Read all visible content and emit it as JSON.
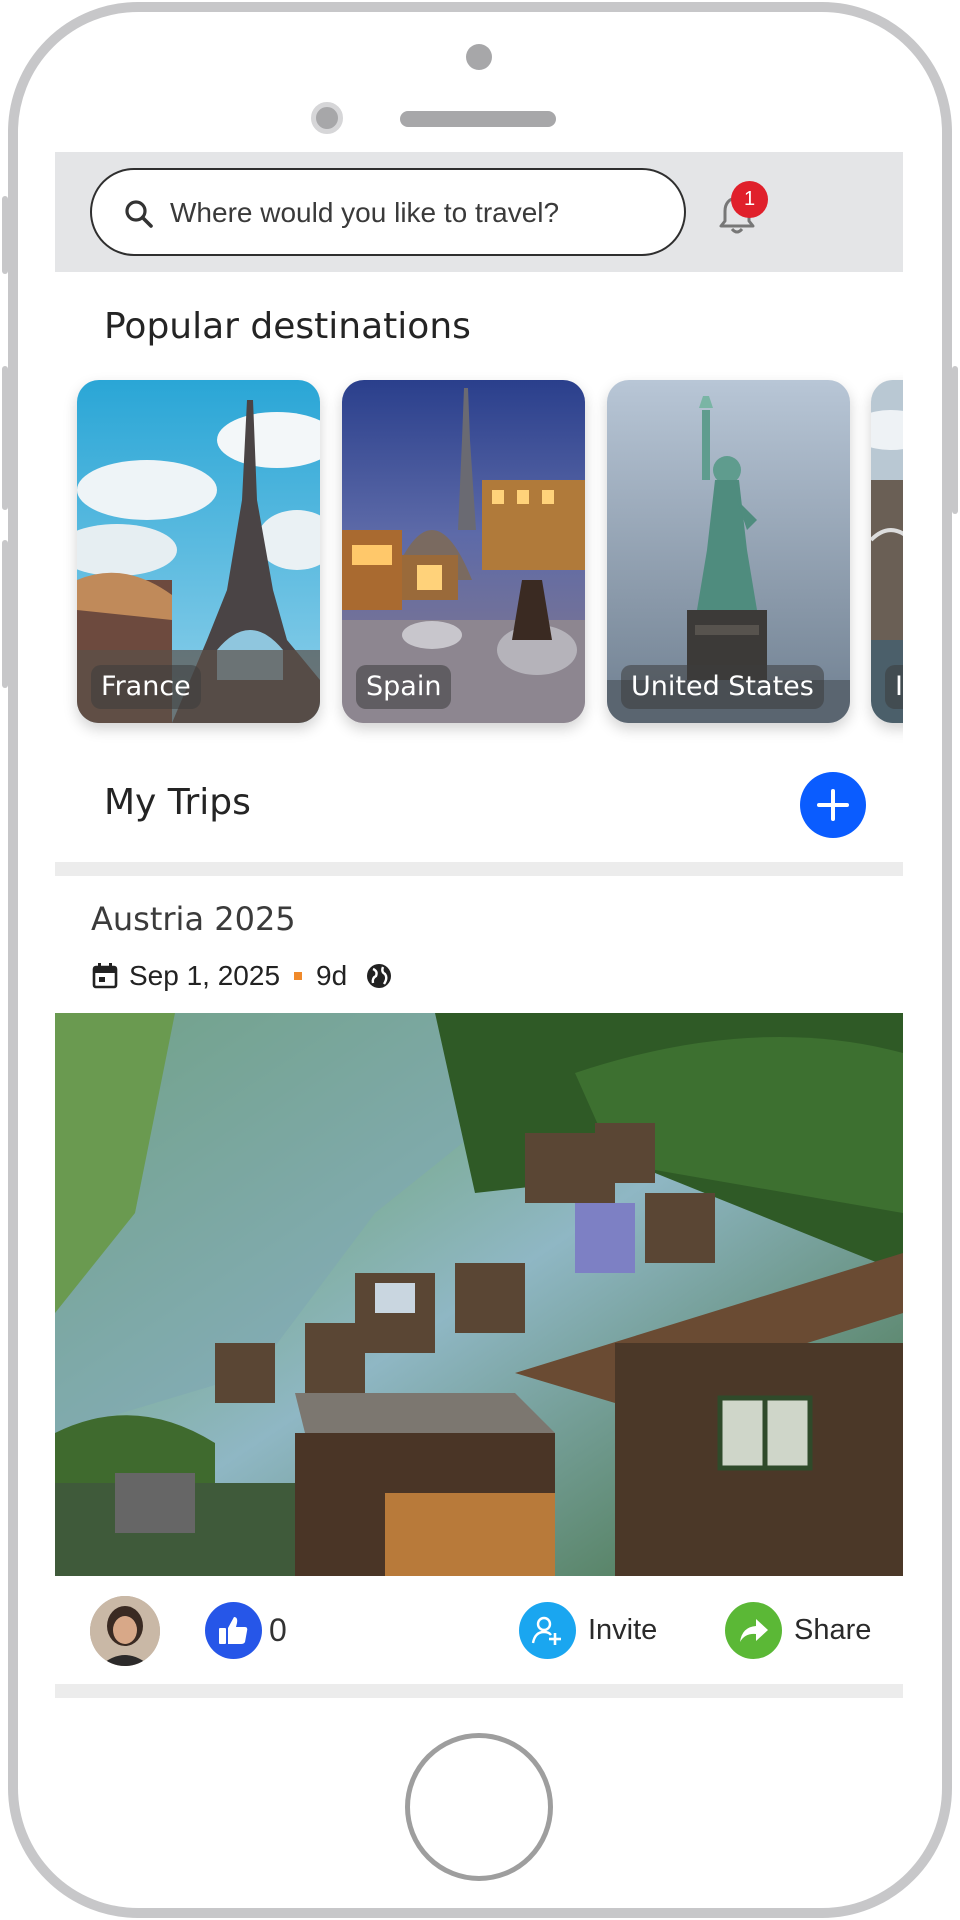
{
  "search": {
    "placeholder": "Where would you like to travel?"
  },
  "notifications": {
    "count": "1"
  },
  "popular": {
    "title": "Popular destinations",
    "destinations": [
      {
        "name": "France"
      },
      {
        "name": "Spain"
      },
      {
        "name": "United States"
      },
      {
        "name": "Italy"
      }
    ]
  },
  "my_trips": {
    "title": "My Trips"
  },
  "trip": {
    "title": "Austria 2025",
    "date": "Sep 1, 2025",
    "duration": "9d",
    "likes": "0",
    "invite_label": "Invite",
    "share_label": "Share"
  },
  "colors": {
    "accent": "#0a5cff",
    "badge": "#e0202b",
    "like": "#2656e8",
    "invite": "#1aa6f0",
    "share": "#5bb836",
    "meta_dot": "#f08a2b"
  }
}
